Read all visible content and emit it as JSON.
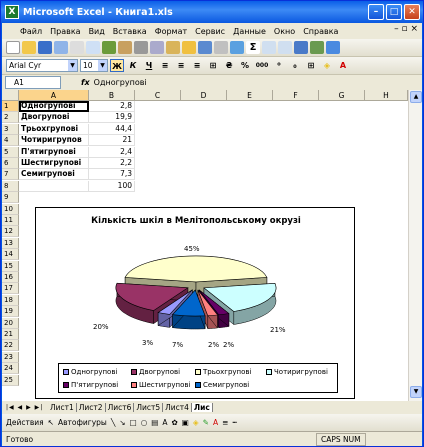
{
  "window": {
    "title": "Microsoft Excel - Книга1.xls",
    "app_letter": "X"
  },
  "menu": {
    "items": [
      "Файл",
      "Правка",
      "Вид",
      "Вставка",
      "Формат",
      "Сервис",
      "Данные",
      "Окно",
      "Справка"
    ]
  },
  "format_toolbar": {
    "font": "Arial Cyr",
    "size": "10",
    "bold": "Ж",
    "italic": "К",
    "underline": "Ч",
    "percent": "%",
    "thousands": "000"
  },
  "formula_bar": {
    "name_box": "A1",
    "fx": "fx",
    "value": "Одногрупові"
  },
  "columns": [
    "A",
    "B",
    "C",
    "D",
    "E",
    "F",
    "G",
    "H"
  ],
  "rows": [
    "1",
    "2",
    "3",
    "4",
    "5",
    "6",
    "7",
    "8",
    "9",
    "10",
    "11",
    "12",
    "13",
    "14",
    "15",
    "16",
    "17",
    "18",
    "19",
    "20",
    "21",
    "22",
    "23",
    "24",
    "25"
  ],
  "table": [
    {
      "a": "Одногрупові",
      "b": "2,8"
    },
    {
      "a": "Двогрупові",
      "b": "19,9"
    },
    {
      "a": "Трьохгрупові",
      "b": "44,4"
    },
    {
      "a": "Чотиригрупов",
      "b": "21"
    },
    {
      "a": "П'ятигрупові",
      "b": "2,4"
    },
    {
      "a": "Шестигрупові",
      "b": "2,2"
    },
    {
      "a": "Семигрупові",
      "b": "7,3"
    },
    {
      "a": "",
      "b": "100"
    }
  ],
  "chart_data": {
    "type": "pie",
    "title": "Кількість шкіл в Мелітопольському окрузі",
    "categories": [
      "Одногрупові",
      "Двогрупові",
      "Трьохгрупові",
      "Чотиригрупові",
      "П'ятигрупові",
      "Шестигрупові",
      "Семигрупові"
    ],
    "values": [
      2.8,
      19.9,
      44.4,
      21,
      2.4,
      2.2,
      7.3
    ],
    "data_labels": [
      "3%",
      "20%",
      "45%",
      "21%",
      "2%",
      "2%",
      "7%"
    ],
    "colors": [
      "#9999ff",
      "#993366",
      "#ffffcc",
      "#ccffff",
      "#660066",
      "#ff8080",
      "#0066cc"
    ],
    "legend_position": "bottom",
    "exploded": true
  },
  "sheet_tabs": [
    "Лист1",
    "Лист2",
    "Лист6",
    "Лист5",
    "Лист4",
    "Лис"
  ],
  "active_tab_index": 5,
  "draw_toolbar": {
    "actions": "Действия",
    "autoshapes": "Автофигуры"
  },
  "status": {
    "ready": "Готово",
    "caps": "CAPS NUM"
  }
}
